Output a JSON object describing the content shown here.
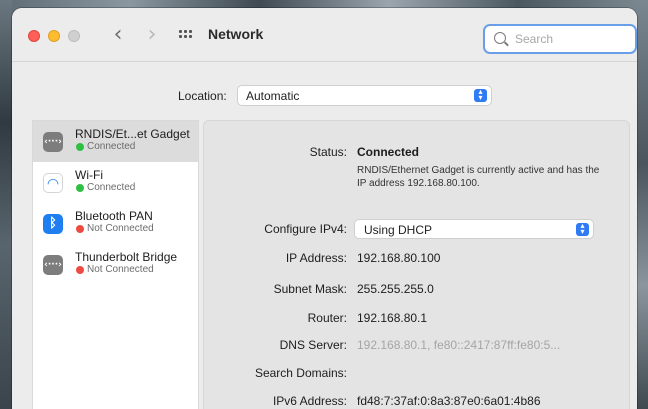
{
  "window": {
    "title": "Network",
    "nav": {
      "back_glyph": "‹",
      "forward_glyph": "›"
    },
    "search": {
      "placeholder": "Search"
    }
  },
  "location": {
    "label": "Location:",
    "value": "Automatic"
  },
  "services": [
    {
      "name": "RNDIS/Et...et Gadget",
      "status": "Connected",
      "status_color": "#2fc043",
      "icon": "ethernet-icon",
      "selected": true
    },
    {
      "name": "Wi-Fi",
      "status": "Connected",
      "status_color": "#2fc043",
      "icon": "wifi-icon",
      "selected": false
    },
    {
      "name": "Bluetooth PAN",
      "status": "Not Connected",
      "status_color": "#ef4a3f",
      "icon": "bluetooth-icon",
      "selected": false
    },
    {
      "name": "Thunderbolt Bridge",
      "status": "Not Connected",
      "status_color": "#ef4a3f",
      "icon": "ethernet-icon",
      "selected": false
    }
  ],
  "details": {
    "status_label": "Status:",
    "status_value": "Connected",
    "status_desc": "RNDIS/Ethernet Gadget is currently active and has the IP address 192.168.80.100.",
    "configure_label": "Configure IPv4:",
    "configure_value": "Using DHCP",
    "ip_label": "IP Address:",
    "ip_value": "192.168.80.100",
    "subnet_label": "Subnet Mask:",
    "subnet_value": "255.255.255.0",
    "router_label": "Router:",
    "router_value": "192.168.80.1",
    "dns_label": "DNS Server:",
    "dns_value": "192.168.80.1, fe80::2417:87ff:fe80:5...",
    "domains_label": "Search Domains:",
    "ipv6_label": "IPv6 Address:",
    "ipv6_value": "fd48:7:37af:0:8a3:87e0:6a01:4b86"
  },
  "colors": {
    "accent": "#2f7bf5",
    "connected": "#2fc043",
    "not_connected": "#ef4a3f"
  }
}
